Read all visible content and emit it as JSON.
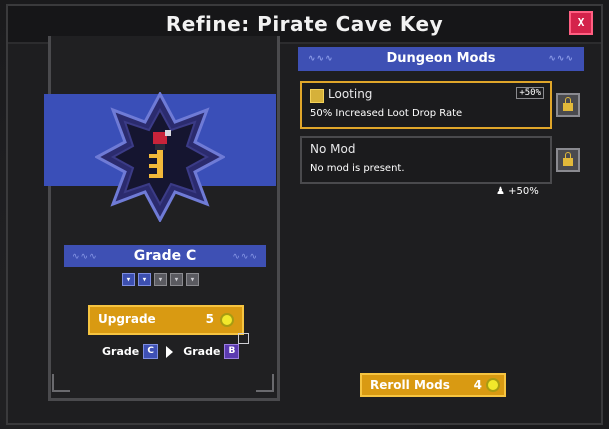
{
  "window": {
    "title": "Refine: Pirate Cave Key",
    "close_label": "X"
  },
  "item": {
    "grade_label": "Grade C",
    "grade_pips": [
      true,
      true,
      false,
      false,
      false
    ]
  },
  "upgrade": {
    "label": "Upgrade",
    "cost": "5",
    "from_prefix": "Grade",
    "from_grade": "C",
    "to_prefix": "Grade",
    "to_grade": "B"
  },
  "mods": {
    "header": "Dungeon Mods",
    "cards": [
      {
        "name": "Looting",
        "desc": "50% Increased Loot Drop Rate",
        "tag": "+50%",
        "locked": true
      },
      {
        "name": "No Mod",
        "desc": "No mod is present.",
        "tag": "",
        "locked": true
      }
    ],
    "bonus": "+50%",
    "reroll_label": "Reroll Mods",
    "reroll_cost": "4"
  },
  "colors": {
    "accent": "#3e50b4",
    "gold": "#d99a12",
    "close": "#d4234b"
  }
}
